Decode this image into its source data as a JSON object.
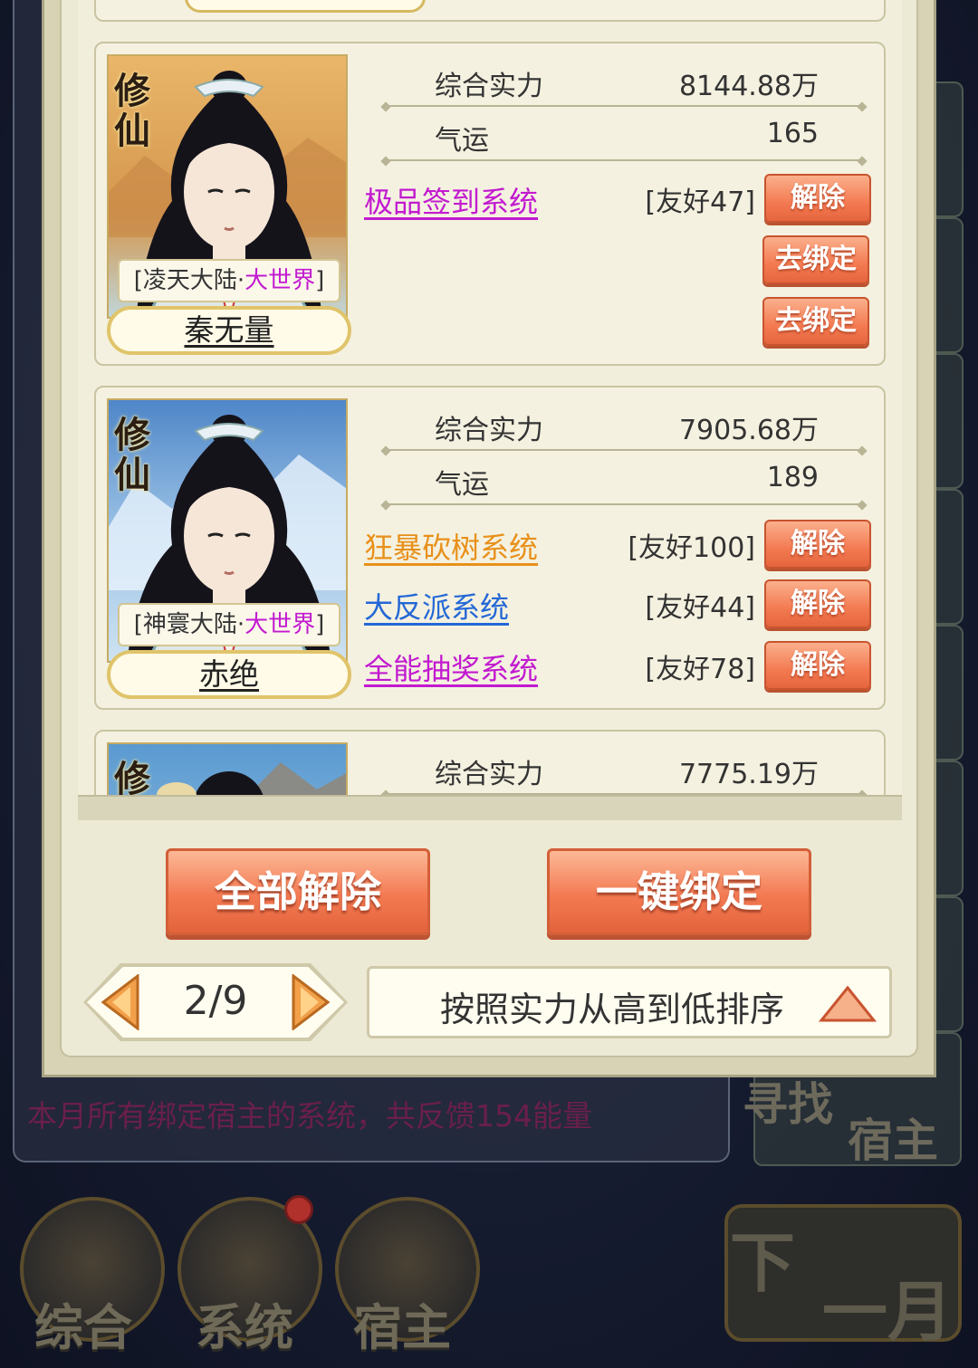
{
  "background": {
    "log_line": "本月所有绑定宿主的系统，共反馈154能量",
    "find_host_label_1": "寻找",
    "find_host_label_2": "宿主",
    "nav": [
      {
        "label": "综合"
      },
      {
        "label": "系统"
      },
      {
        "label": "宿主"
      }
    ],
    "next_month_1": "下",
    "next_month_2": "一月"
  },
  "cards": [
    {
      "badge_1": "修",
      "badge_2": "仙",
      "world_prefix": "[凌天大陆·",
      "world_tier": "大世界",
      "world_suffix": "]",
      "name": "秦无量",
      "power_label": "综合实力",
      "power_value": "8144.88万",
      "luck_label": "气运",
      "luck_value": "165",
      "systems": [
        {
          "name": "极品签到系统",
          "friend": "[友好47]",
          "action": "解除",
          "color": "#c21ad0"
        }
      ],
      "extra_buttons": [
        "去绑定",
        "去绑定"
      ]
    },
    {
      "badge_1": "修",
      "badge_2": "仙",
      "world_prefix": "[神寰大陆·",
      "world_tier": "大世界",
      "world_suffix": "]",
      "name": "赤绝",
      "power_label": "综合实力",
      "power_value": "7905.68万",
      "luck_label": "气运",
      "luck_value": "189",
      "systems": [
        {
          "name": "狂暴砍树系统",
          "friend": "[友好100]",
          "action": "解除",
          "color": "#e8901a"
        },
        {
          "name": "大反派系统",
          "friend": "[友好44]",
          "action": "解除",
          "color": "#2468d6"
        },
        {
          "name": "全能抽奖系统",
          "friend": "[友好78]",
          "action": "解除",
          "color": "#c21ad0"
        }
      ]
    },
    {
      "badge_1": "修",
      "power_label": "综合实力",
      "power_value": "7775.19万"
    }
  ],
  "actions": {
    "release_all": "全部解除",
    "bind_all": "一键绑定"
  },
  "pager": {
    "page": "2/9"
  },
  "sort": {
    "label": "按照实力从高到低排序"
  },
  "colors": {
    "accent_button": "#f37a52",
    "panel_bg": "#ece9d4",
    "tier_highlight": "#c21ad0"
  }
}
